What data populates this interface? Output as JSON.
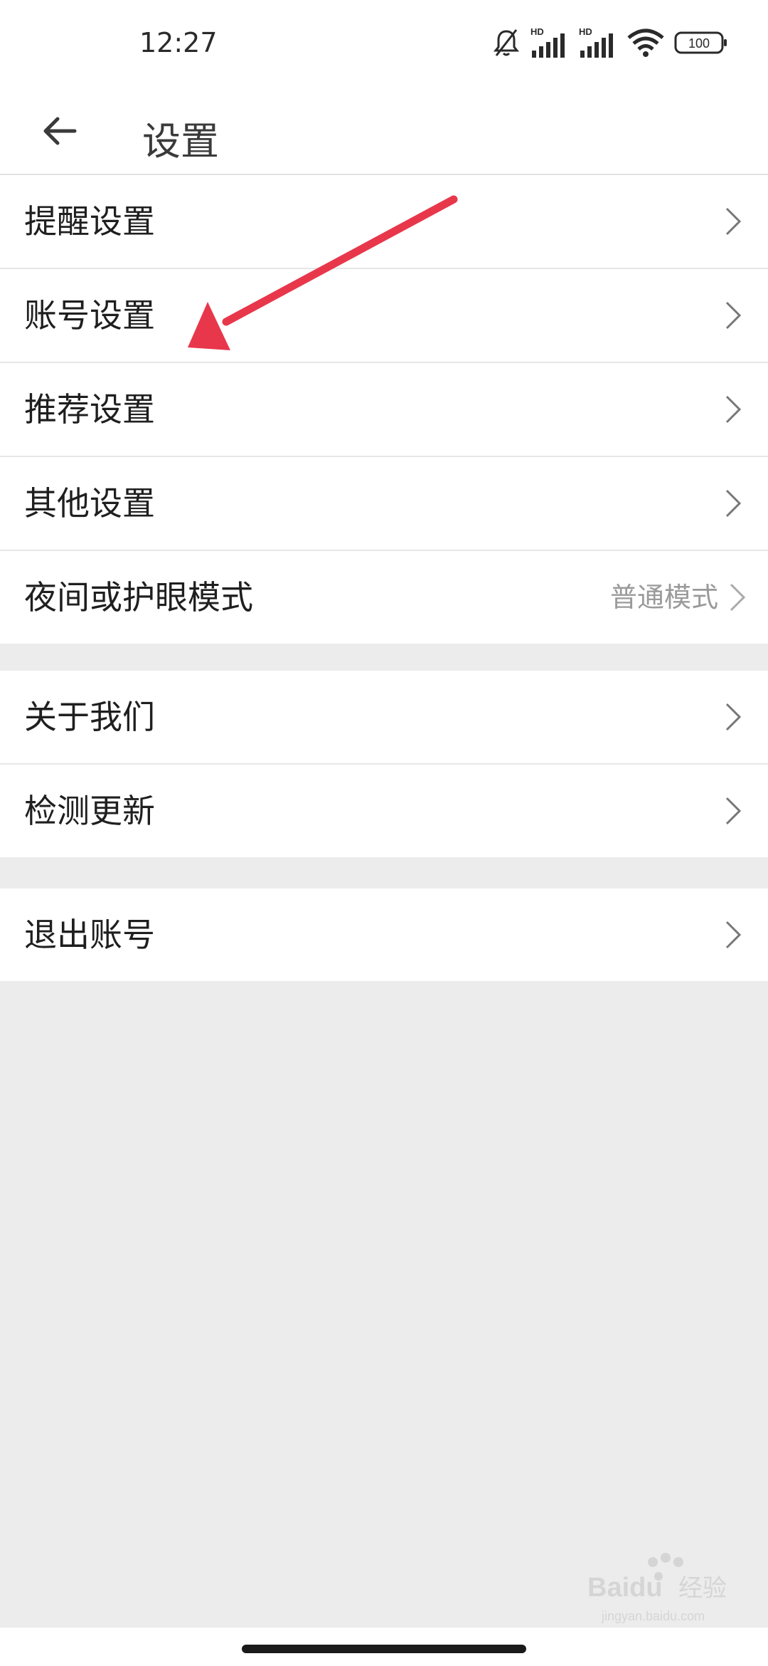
{
  "status": {
    "time": "12:27",
    "battery": "100",
    "network_1": "HD",
    "network_2": "HD"
  },
  "header": {
    "title": "设置"
  },
  "group1": [
    {
      "label": "提醒设置"
    },
    {
      "label": "账号设置"
    },
    {
      "label": "推荐设置"
    },
    {
      "label": "其他设置"
    },
    {
      "label": "夜间或护眼模式",
      "value": "普通模式"
    }
  ],
  "group2": [
    {
      "label": "关于我们"
    },
    {
      "label": "检测更新"
    }
  ],
  "group3": [
    {
      "label": "退出账号"
    }
  ],
  "watermark": {
    "brand": "Baidu",
    "brand_cn": "经验",
    "url": "jingyan.baidu.com"
  },
  "colors": {
    "annotation_arrow": "#e8374b",
    "background": "#ececec"
  }
}
